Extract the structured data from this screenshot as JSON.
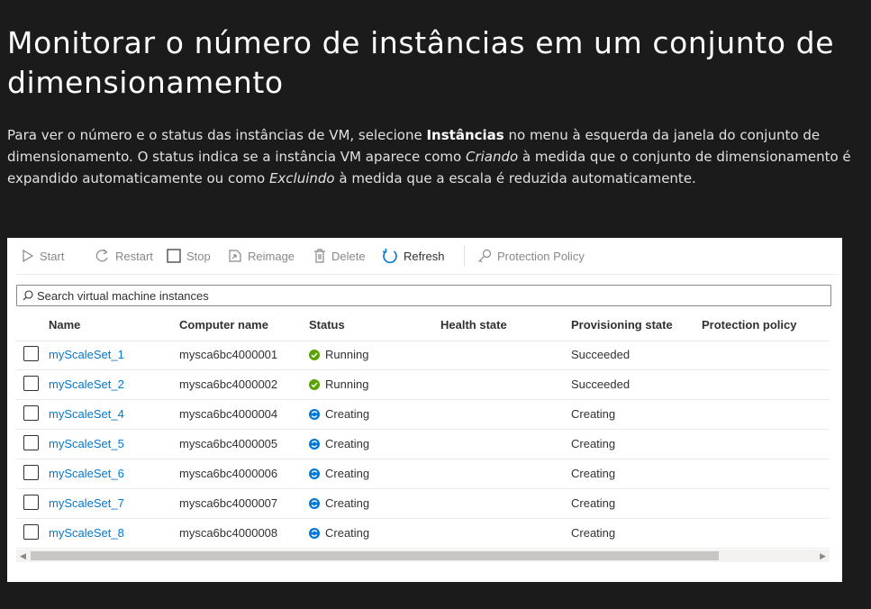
{
  "title": "Monitorar o número de instâncias em um conjunto de dimensionamento",
  "description": {
    "p1": "Para ver o número e o status das instâncias de VM, selecione ",
    "bold1": "Instâncias",
    "p2": " no menu à esquerda da janela do conjunto de dimensionamento. O status indica se a instância VM aparece como ",
    "italic1": "Criando",
    "p3": " à medida que o conjunto de dimensionamento é expandido automaticamente ou como ",
    "italic2": "Excluindo",
    "p4": " à medida que a escala é reduzida automaticamente."
  },
  "toolbar": {
    "start": "Start",
    "restart": "Restart",
    "stop": "Stop",
    "reimage": "Reimage",
    "delete": "Delete",
    "refresh": "Refresh",
    "protection": "Protection Policy"
  },
  "search": {
    "placeholder": "Search virtual machine instances"
  },
  "columns": {
    "name": "Name",
    "computer": "Computer name",
    "status": "Status",
    "health": "Health state",
    "provisioning": "Provisioning state",
    "protection": "Protection policy"
  },
  "rows": [
    {
      "name": "myScaleSet_1",
      "computer": "mysca6bc4000001",
      "status": "Running",
      "provisioning": "Succeeded"
    },
    {
      "name": "myScaleSet_2",
      "computer": "mysca6bc4000002",
      "status": "Running",
      "provisioning": "Succeeded"
    },
    {
      "name": "myScaleSet_4",
      "computer": "mysca6bc4000004",
      "status": "Creating",
      "provisioning": "Creating"
    },
    {
      "name": "myScaleSet_5",
      "computer": "mysca6bc4000005",
      "status": "Creating",
      "provisioning": "Creating"
    },
    {
      "name": "myScaleSet_6",
      "computer": "mysca6bc4000006",
      "status": "Creating",
      "provisioning": "Creating"
    },
    {
      "name": "myScaleSet_7",
      "computer": "mysca6bc4000007",
      "status": "Creating",
      "provisioning": "Creating"
    },
    {
      "name": "myScaleSet_8",
      "computer": "mysca6bc4000008",
      "status": "Creating",
      "provisioning": "Creating"
    }
  ],
  "icons": {
    "running": "check-circle-icon",
    "creating": "sync-circle-icon"
  },
  "colors": {
    "page_bg": "#1b1b1b",
    "link": "#0078d4",
    "running": "#57a300",
    "creating": "#0078d4"
  }
}
